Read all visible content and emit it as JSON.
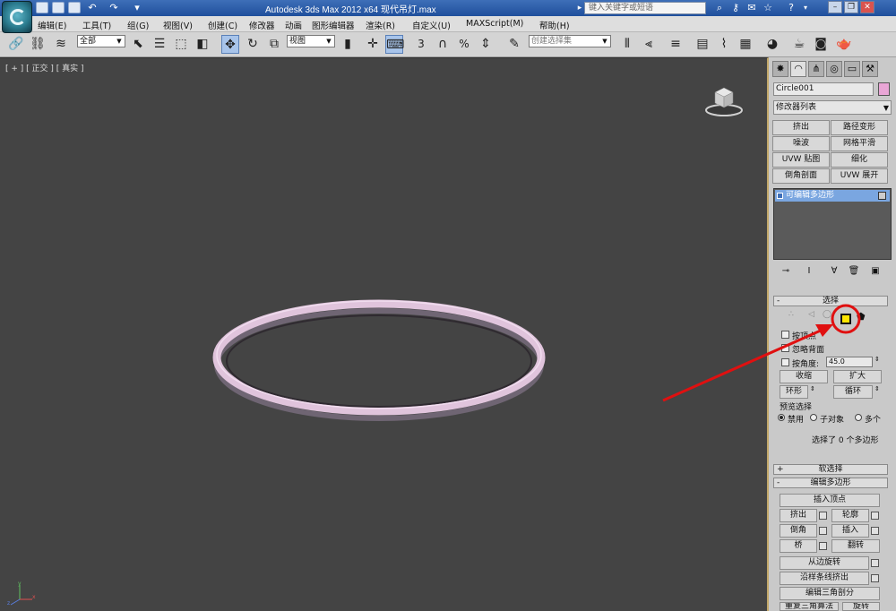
{
  "titlebar": {
    "title": "Autodesk 3ds Max  2012 x64     现代吊灯.max",
    "search_placeholder": "键入关键字或短语",
    "accent": "#2b5aa8"
  },
  "menu": {
    "items": [
      "编辑(E)",
      "工具(T)",
      "组(G)",
      "视图(V)",
      "创建(C)",
      "修改器",
      "动画",
      "图形编辑器",
      "渲染(R)",
      "自定义(U)",
      "MAXScript(M)",
      "帮助(H)"
    ]
  },
  "toolbar": {
    "filter_value": "全部",
    "refcoord_value": "视图",
    "named_selection_value": "创建选择集",
    "snap_label": "3",
    "percent_label": "%"
  },
  "viewport": {
    "label": "[ + ] [ 正交 ] [ 真实 ]",
    "background": "#444444",
    "object_color": "#e0c4dc"
  },
  "panel": {
    "object_name": "Circle001",
    "object_color": "#e9a6d6",
    "modifier_list": "修改器列表",
    "modifier_buttons": [
      "挤出",
      "路径变形",
      "噪波",
      "网格平滑",
      "UVW 贴图",
      "细化",
      "倒角剖面",
      "UVW 展开"
    ],
    "stack_item": "可编辑多边形",
    "selection": {
      "title": "选择",
      "by_vertex": "按顶点",
      "ignore_backfacing": "忽略背面",
      "by_angle": "按角度:",
      "angle_value": "45.0",
      "shrink": "收缩",
      "grow": "扩大",
      "ring": "环形",
      "loop": "循环",
      "preview_title": "预览选择",
      "preview_off": "禁用",
      "preview_subobj": "子对象",
      "preview_multi": "多个",
      "status": "选择了 0 个多边形"
    },
    "soft_selection": "软选择",
    "edit_polygons": {
      "title": "编辑多边形",
      "insert_vertex": "插入顶点",
      "extrude": "挤出",
      "outline": "轮廓",
      "bevel": "倒角",
      "inset": "插入",
      "bridge": "桥",
      "flip": "翻转",
      "hinge": "从边旋转",
      "extrude_along_spline": "沿样条线挤出",
      "edit_triangulation": "编辑三角剖分"
    },
    "bottom_partial_left": "重复三角算法",
    "bottom_partial_right": "旋转"
  },
  "annotation": {
    "color": "#e01010",
    "highlight_color": "#ffe600"
  }
}
